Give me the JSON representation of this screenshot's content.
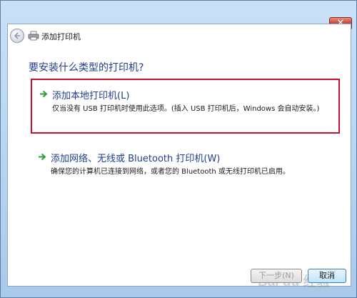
{
  "window": {
    "title": "添加打印机",
    "close_label": "✕"
  },
  "main": {
    "question": "要安装什么类型的打印机?",
    "options": [
      {
        "title": "添加本地打印机(L)",
        "description": "仅当没有 USB 打印机时使用此选项。(插入 USB 打印机后，Windows 会自动安装。)",
        "selected": true
      },
      {
        "title": "添加网络、无线或 Bluetooth 打印机(W)",
        "description": "确保您的计算机已连接到网络，或者您的 Bluetooth 或无线打印机已启用。",
        "selected": false
      }
    ]
  },
  "footer": {
    "next_label": "下一步(N)",
    "cancel_label": "取消"
  },
  "watermark": {
    "text": "Bai du 经验"
  },
  "colors": {
    "heading": "#1f3e8c",
    "selection_border": "#c8102e",
    "arrow": "#2e9e3a"
  },
  "icons": {
    "back": "back-arrow-icon",
    "printer": "printer-icon",
    "option_arrow": "green-arrow-icon",
    "close": "close-icon"
  }
}
